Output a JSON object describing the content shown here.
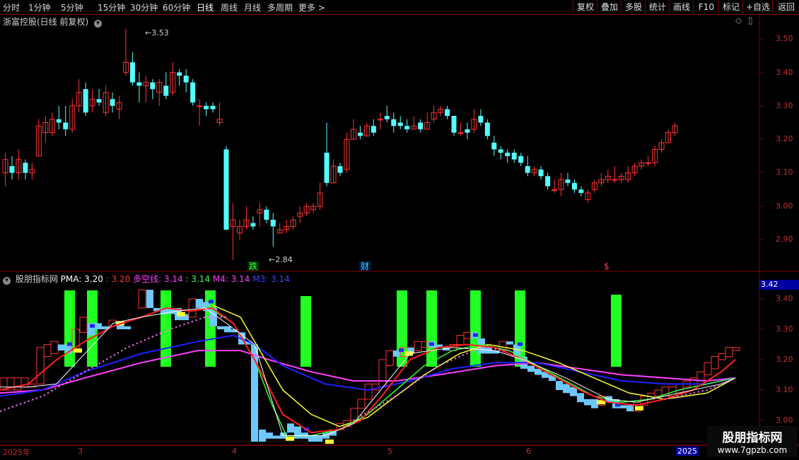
{
  "toolbar": {
    "periods": [
      "分时",
      "1分钟",
      "5分钟",
      "15分钟",
      "30分钟",
      "60分钟",
      "日线",
      "周线",
      "月线",
      "多周期",
      "更多 >"
    ],
    "active_period": "日线",
    "right_buttons": [
      "复权",
      "叠加",
      "多股",
      "统计",
      "画线",
      "F10",
      "标记",
      "+自选",
      "返回"
    ]
  },
  "main_panel": {
    "title": "浙富控股(日线 前复权)",
    "high_label": "3.53",
    "low_label": "2.84",
    "y_ticks": [
      "3.50",
      "3.40",
      "3.30",
      "3.20",
      "3.10",
      "3.00",
      "2.90"
    ],
    "markers": [
      {
        "text": "跌",
        "color": "#40ff40"
      },
      {
        "text": "财",
        "color": "#40c0ff"
      },
      {
        "text": "$",
        "color": "#ff4040"
      }
    ]
  },
  "indicator_panel": {
    "name": "股朋指标网",
    "legend": [
      {
        "label": "PMA: 3.20",
        "color": "#ffffff"
      },
      {
        "label": ": 3.20",
        "color": "#ff3030"
      },
      {
        "label": "多空线: 3.14",
        "color": "#ff40ff"
      },
      {
        "label": ": 3.14",
        "color": "#40ff40"
      },
      {
        "label": "M4: 3.14",
        "color": "#ff40ff"
      },
      {
        "label": "M3: 3.14",
        "color": "#4040ff"
      }
    ],
    "current_value": "3.42",
    "y_ticks": [
      "3.40",
      "3.30",
      "3.20",
      "3.10",
      "3.00"
    ]
  },
  "date_axis": {
    "labels": [
      "2025年",
      "3",
      "4",
      "5",
      "6",
      "2025"
    ]
  },
  "watermark": {
    "title": "股朋指标网",
    "url": "www.7gpzb.com"
  },
  "colors": {
    "up": "#ff3232",
    "down": "#54ffff",
    "grid_border": "#800000",
    "axis_text": "#c03030"
  }
}
